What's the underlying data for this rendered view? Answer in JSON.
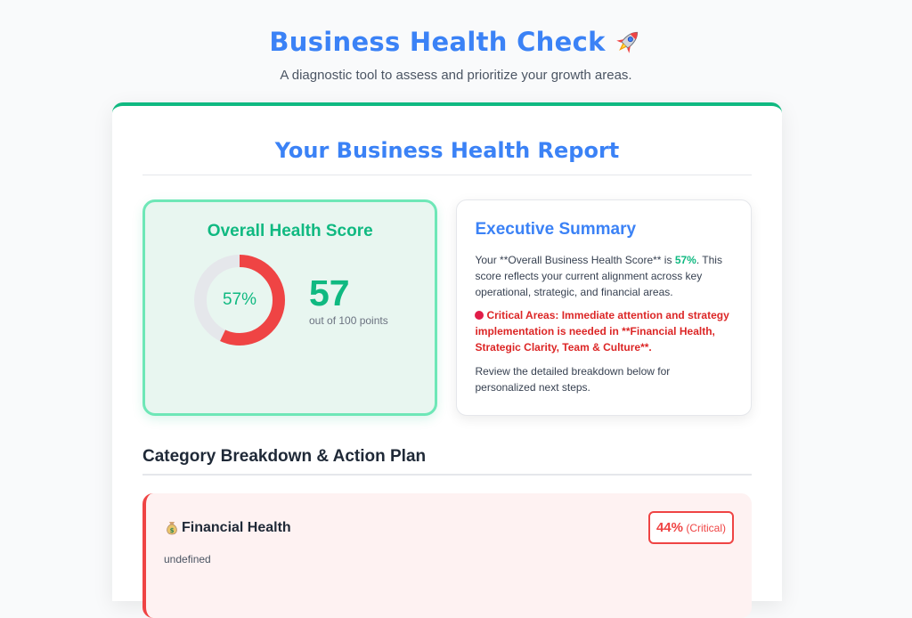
{
  "header": {
    "title": "Business Health Check",
    "title_icon": "rocket-icon",
    "subtitle": "A diagnostic tool to assess and prioritize your growth areas."
  },
  "report": {
    "title": "Your Business Health Report",
    "score": {
      "heading": "Overall Health Score",
      "percent_label": "57%",
      "percent_value": 57,
      "value": "57",
      "caption": "out of 100 points",
      "ring_color": "#ef4444",
      "track_color": "#e5e7eb"
    },
    "summary": {
      "heading": "Executive Summary",
      "p1_prefix": "Your **Overall Business Health Score** is ",
      "p1_pct": "57%",
      "p1_suffix": ". This score reflects your current alignment across key operational, strategic, and financial areas.",
      "critical_text": "Critical Areas: Immediate attention and strategy implementation is needed in **Financial Health, Strategic Clarity, Team & Culture**.",
      "review_text": "Review the detailed breakdown below for personalized next steps."
    },
    "breakdown": {
      "heading": "Category Breakdown & Action Plan",
      "categories": [
        {
          "icon": "moneybag-icon",
          "name": "Financial Health",
          "percent": "44%",
          "status": "(Critical)",
          "description": "undefined"
        }
      ]
    }
  },
  "colors": {
    "accent_blue": "#3b82f6",
    "accent_green": "#10b981",
    "critical_red": "#ef4444"
  }
}
